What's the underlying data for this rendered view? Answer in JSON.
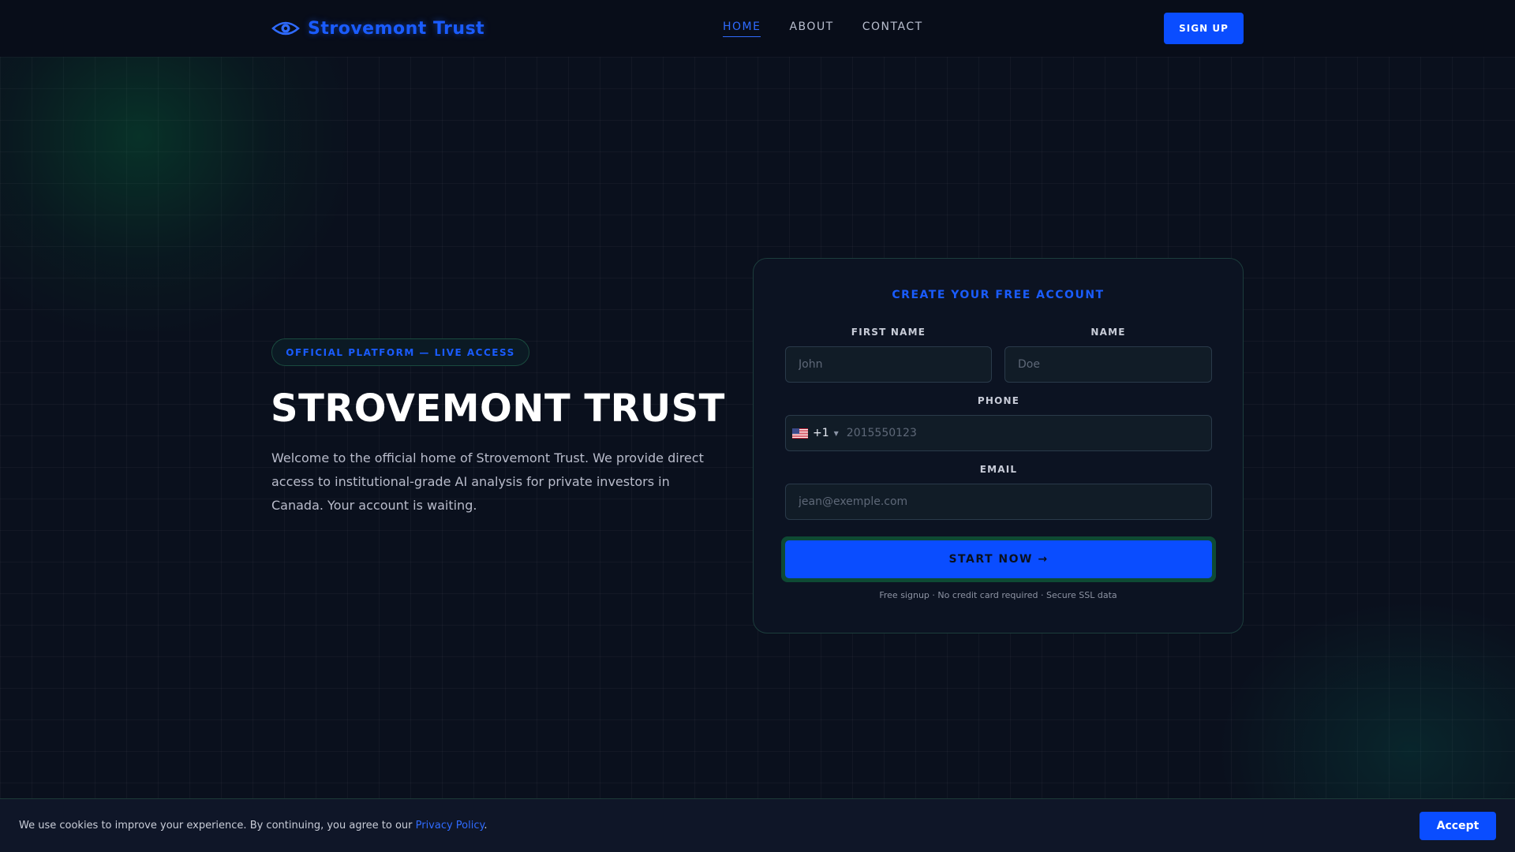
{
  "header": {
    "brand": "Strovemont Trust",
    "brand_icon": "eye-icon",
    "nav": [
      {
        "label": "HOME",
        "active": true
      },
      {
        "label": "ABOUT",
        "active": false
      },
      {
        "label": "CONTACT",
        "active": false
      }
    ],
    "signup_label": "SIGN UP"
  },
  "hero": {
    "badge": "OFFICIAL PLATFORM — LIVE ACCESS",
    "title": "STROVEMONT TRUST",
    "description": "Welcome to the official home of Strovemont Trust. We provide direct access to institutional-grade AI analysis for private investors in Canada. Your account is waiting."
  },
  "form": {
    "title": "CREATE YOUR FREE ACCOUNT",
    "first_name_label": "FIRST NAME",
    "first_name_placeholder": "John",
    "last_name_label": "NAME",
    "last_name_placeholder": "Doe",
    "phone_label": "PHONE",
    "phone_country_icon": "us-flag-icon",
    "phone_dial_code": "+1",
    "phone_placeholder": "2015550123",
    "email_label": "EMAIL",
    "email_placeholder": "jean@exemple.com",
    "submit_label": "START NOW →",
    "fine_print": "Free signup · No credit card required · Secure SSL data"
  },
  "cookie": {
    "text_before": "We use cookies to improve your experience. By continuing, you agree to our ",
    "link_label": "Privacy Policy",
    "text_after": ".",
    "accept_label": "Accept"
  },
  "colors": {
    "accent": "#0a4dff",
    "background": "#0a101d",
    "border_teal": "#1c3d3c"
  }
}
